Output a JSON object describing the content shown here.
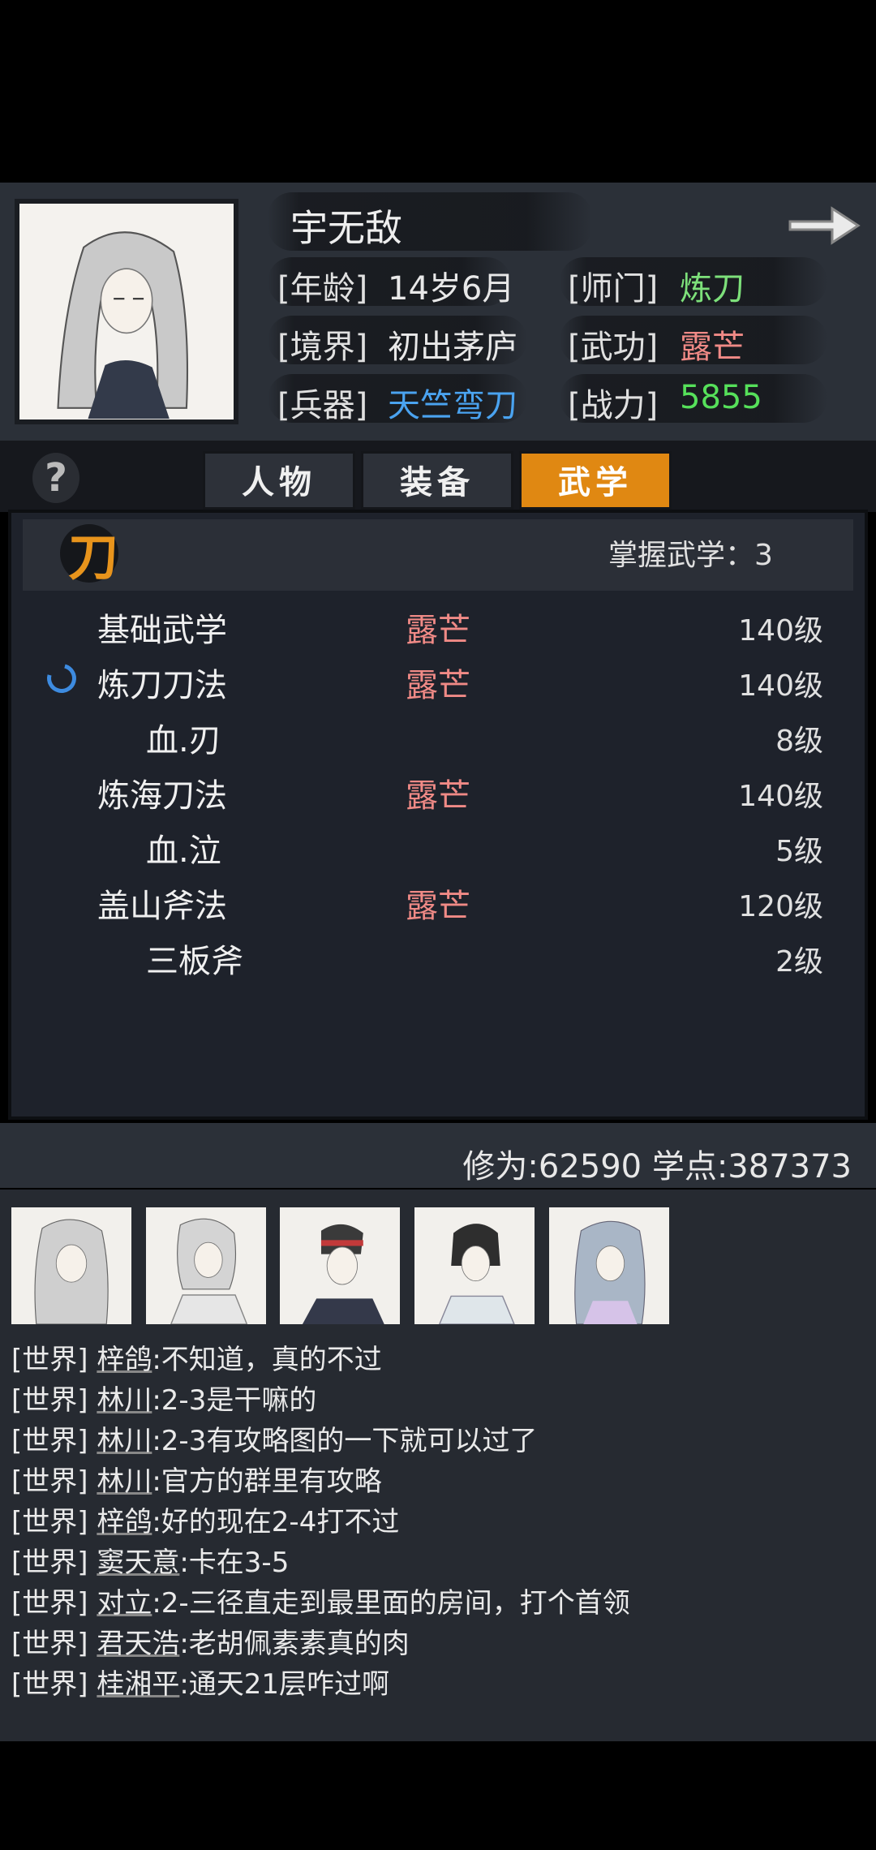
{
  "header": {
    "name": "宇无敌",
    "age_label": "[年龄]",
    "age_value": "14岁6月",
    "school_label": "[师门]",
    "school_value": "炼刀",
    "realm_label": "[境界]",
    "realm_value": "初出茅庐",
    "skill_label": "[武功]",
    "skill_value": "露芒",
    "weapon_label": "[兵器]",
    "weapon_value": "天竺弯刀",
    "power_label": "[战力]",
    "power_value": "5855"
  },
  "tabs": [
    {
      "label": "人物"
    },
    {
      "label": "装备"
    },
    {
      "label": "武学",
      "active": true
    }
  ],
  "panel": {
    "icon_char": "刀",
    "mastered": "掌握武学：3",
    "rows": [
      {
        "name": "基础武学",
        "realm": "露芒",
        "level": "140级"
      },
      {
        "name": "炼刀刀法",
        "realm": "露芒",
        "level": "140级"
      },
      {
        "name": "血.刃",
        "realm": "",
        "level": "8级"
      },
      {
        "name": "炼海刀法",
        "realm": "露芒",
        "level": "140级"
      },
      {
        "name": "血.泣",
        "realm": "",
        "level": "5级"
      },
      {
        "name": "盖山斧法",
        "realm": "露芒",
        "level": "120级"
      },
      {
        "name": "三板斧",
        "realm": "",
        "level": "2级"
      }
    ]
  },
  "stats": "修为:62590  学点:387373",
  "chat": [
    {
      "channel": "[世界]",
      "user": "梓鸽",
      "text": ":不知道，真的不过"
    },
    {
      "channel": "[世界]",
      "user": "林川",
      "text": ":2-3是干嘛的"
    },
    {
      "channel": "[世界]",
      "user": "林川",
      "text": ":2-3有攻略图的一下就可以过了"
    },
    {
      "channel": "[世界]",
      "user": "林川",
      "text": ":官方的群里有攻略"
    },
    {
      "channel": "[世界]",
      "user": "梓鸽",
      "text": ":好的现在2-4打不过"
    },
    {
      "channel": "[世界]",
      "user": "窦天意",
      "text": ":卡在3-5"
    },
    {
      "channel": "[世界]",
      "user": "对立",
      "text": ":2-三径直走到最里面的房间，打个首领"
    },
    {
      "channel": "[世界]",
      "user": "君天浩",
      "text": ":老胡佩素素真的肉"
    },
    {
      "channel": "[世界]",
      "user": "桂湘平",
      "text": ":通天21层咋过啊"
    }
  ],
  "colors": {
    "school": "#7de07a",
    "skill": "#f08a86",
    "weapon": "#4aa3f0",
    "power": "#56e05a",
    "active_tab": "#e08812"
  },
  "icons": [
    "arrow-right-icon",
    "help-icon",
    "blade-icon",
    "spinner-icon",
    "portrait-icon"
  ]
}
